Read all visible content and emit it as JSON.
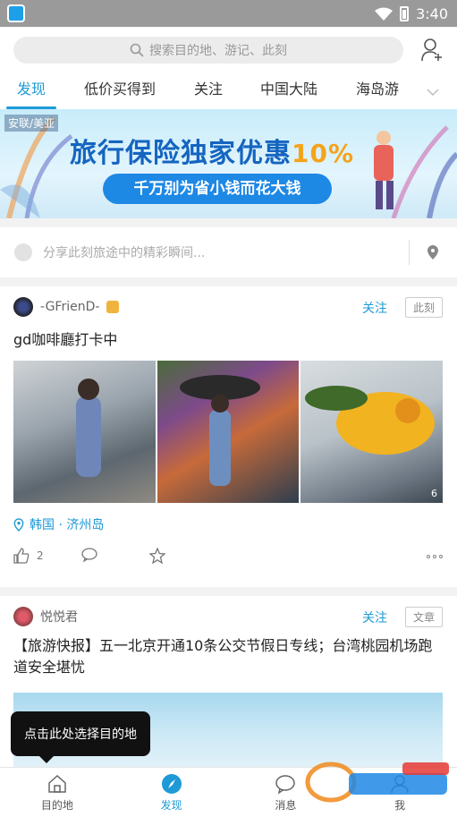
{
  "status_bar": {
    "time": "3:40"
  },
  "header": {
    "search_placeholder": "搜索目的地、游记、此刻",
    "tabs": [
      {
        "label": "发现",
        "active": true
      },
      {
        "label": "低价买得到"
      },
      {
        "label": "关注"
      },
      {
        "label": "中国大陆"
      },
      {
        "label": "海岛游"
      }
    ]
  },
  "banner": {
    "tag": "安联/美亚",
    "title": "旅行保险独家优惠",
    "title_highlight": "10%",
    "subtitle": "千万别为省小钱而花大钱"
  },
  "share": {
    "placeholder": "分享此刻旅途中的精彩瞬间..."
  },
  "posts": [
    {
      "user": "-GFrienD-",
      "follow": "关注",
      "type": "此刻",
      "title": "gd咖啡廳打卡中",
      "photo_count": "6",
      "location": "韩国 · 济州岛",
      "likes": "2"
    },
    {
      "user": "悦悦君",
      "follow": "关注",
      "type": "文章",
      "title": "【旅游快报】五一北京开通10条公交节假日专线；台湾桃园机场跑道安全堪忧"
    }
  ],
  "tooltip": "点击此处选择目的地",
  "bottom_nav": [
    {
      "label": "目的地"
    },
    {
      "label": "发现",
      "active": true
    },
    {
      "label": "消息"
    },
    {
      "label": "我"
    }
  ],
  "colors": {
    "accent": "#1e9ad6",
    "banner_blue": "#1565c0",
    "banner_orange": "#f5a31a"
  }
}
